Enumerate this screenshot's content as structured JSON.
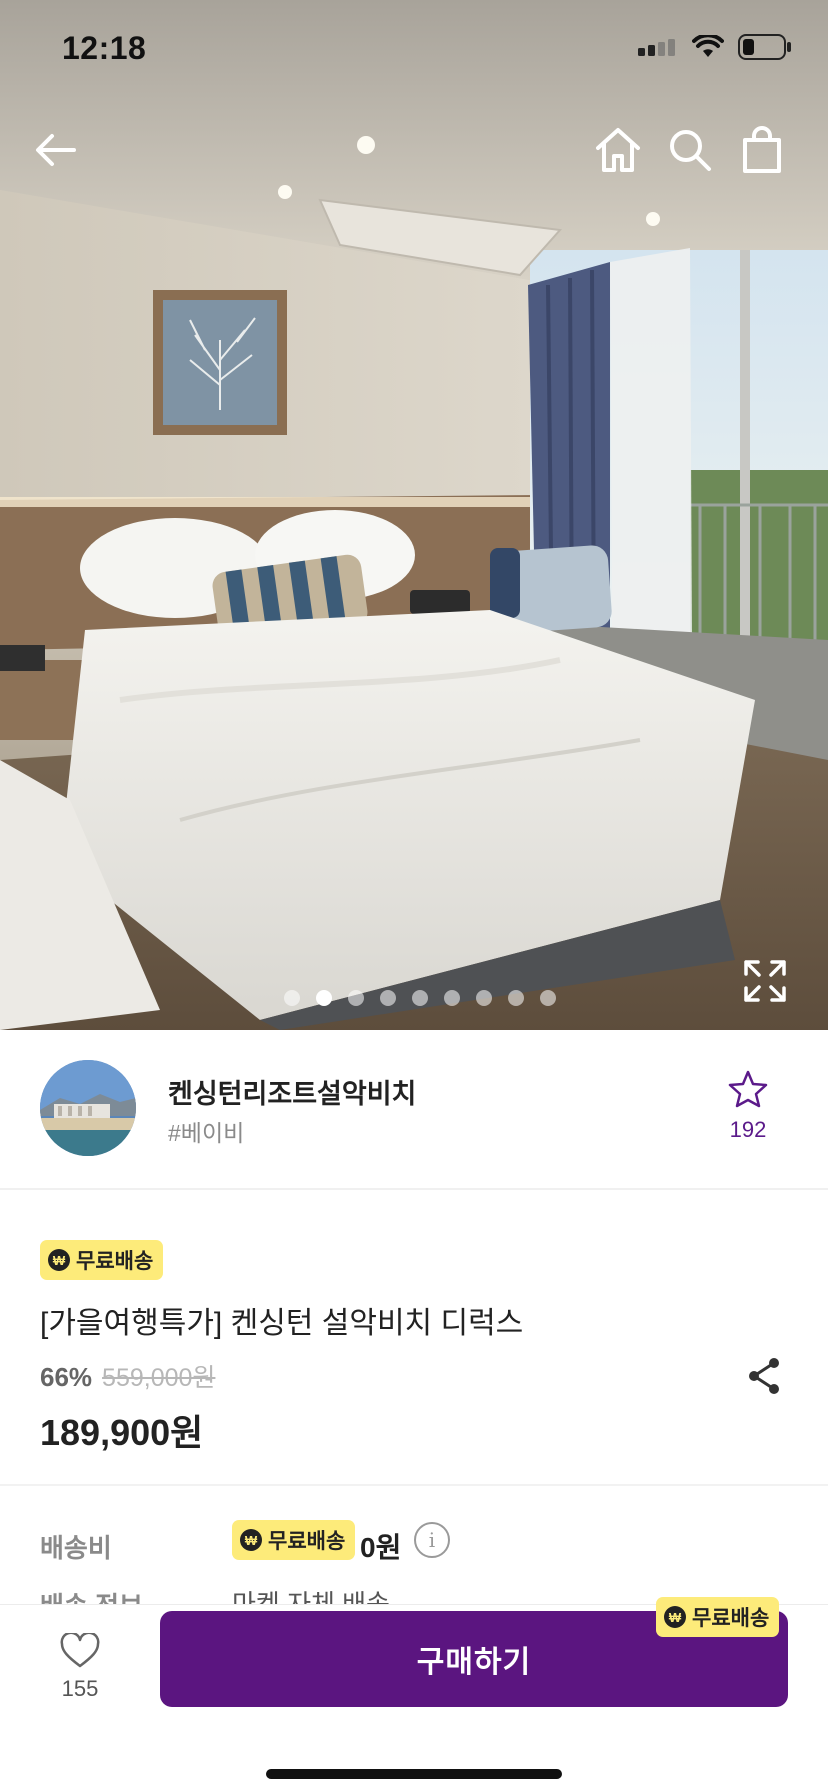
{
  "status_bar": {
    "time": "12:18"
  },
  "carousel": {
    "total_slides": 9,
    "active_index": 1
  },
  "seller": {
    "name": "켄싱턴리조트설악비치",
    "tag": "#베이비",
    "favorite_count": "192"
  },
  "product": {
    "badge": "무료배송",
    "title": "[가을여행특가] 켄싱턴 설악비치 디럭스",
    "discount_rate": "66%",
    "original_price": "559,000원",
    "final_price": "189,900원"
  },
  "shipping": {
    "fee_label": "배송비",
    "badge": "무료배송",
    "fee_value": "0원",
    "info_label": "배송 정보",
    "info_value": "마켓 자체 배송"
  },
  "bottom_bar": {
    "like_count": "155",
    "buy_label": "구매하기",
    "buy_badge": "무료배송"
  },
  "badge_currency_symbol": "₩",
  "info_symbol": "i",
  "colors": {
    "brand_purple": "#5b1580",
    "badge_yellow": "#fdeb7a"
  }
}
